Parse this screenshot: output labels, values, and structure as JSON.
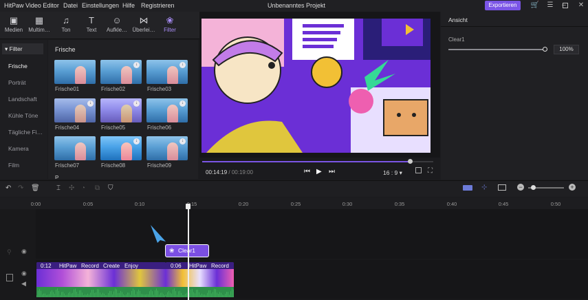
{
  "titlebar": {
    "app": "HitPaw Video Editor",
    "menus": [
      "Datei",
      "Einstellungen",
      "Hilfe",
      "Registrieren"
    ],
    "project": "Unbenanntes Projekt",
    "export": "Exportieren"
  },
  "tools": [
    {
      "label": "Medien",
      "icon": "media-icon"
    },
    {
      "label": "Multim…",
      "icon": "multimedia-icon"
    },
    {
      "label": "Ton",
      "icon": "music-note-icon"
    },
    {
      "label": "Text",
      "icon": "text-icon"
    },
    {
      "label": "Aufkle…",
      "icon": "sticker-icon"
    },
    {
      "label": "Überlei…",
      "icon": "transition-icon"
    },
    {
      "label": "Filter",
      "icon": "filter-icon"
    }
  ],
  "filter_nav": {
    "header": "Filter",
    "items": [
      "Frische",
      "Porträt",
      "Landschaft",
      "Kühle Töne",
      "Tägliche Fi…",
      "Kamera",
      "Film"
    ]
  },
  "grid": {
    "title": "Frische",
    "items": [
      "Frische01",
      "Frische02",
      "Frische03",
      "Frische04",
      "Frische05",
      "Frische06",
      "Frische07",
      "Frische08",
      "Frische09"
    ],
    "next_label": "P"
  },
  "player": {
    "current": "00:14:19",
    "separator": "/",
    "total": "00:19:00",
    "ratio": "16 : 9",
    "progress": 0.9
  },
  "right_panel": {
    "title": "Ansicht",
    "layer": "Clear1",
    "value": "100%"
  },
  "ruler": [
    "0:00",
    "0:05",
    "0:10",
    "0:15",
    "0:20",
    "0:25",
    "0:30",
    "0:35",
    "0:40",
    "0:45",
    "0:50"
  ],
  "timeline": {
    "filter_clip": "Clear1",
    "clip1": {
      "duration": "0:12",
      "labels": [
        "HitPaw",
        "Record",
        "Create",
        "Enjoy"
      ]
    },
    "clip2": {
      "duration": "0:06",
      "labels": [
        "HitPaw",
        "Record"
      ]
    }
  },
  "colors": {
    "accent": "#7b55e6",
    "playhead": "#eeeeee",
    "waveform": "#3fae5a"
  }
}
